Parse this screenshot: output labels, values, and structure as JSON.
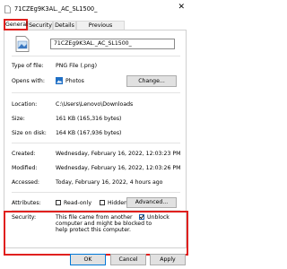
{
  "window": {
    "title": "71CZEg9K3AL._AC_SL1500_",
    "close_glyph": "✕"
  },
  "tabs": [
    {
      "label": "General",
      "active": true
    },
    {
      "label": "Security"
    },
    {
      "label": "Details"
    },
    {
      "label": "Previous Versions"
    }
  ],
  "file": {
    "name": "71CZEg9K3AL._AC_SL1500_"
  },
  "type": {
    "label": "Type of file:",
    "value": "PNG File (.png)"
  },
  "opens": {
    "label": "Opens with:",
    "value": "Photos",
    "button": "Change..."
  },
  "location": {
    "label": "Location:",
    "value": "C:\\Users\\Lenovo\\Downloads"
  },
  "size": {
    "label": "Size:",
    "value": "161 KB (165,316 bytes)"
  },
  "size_on_disk": {
    "label": "Size on disk:",
    "value": "164 KB (167,936 bytes)"
  },
  "created": {
    "label": "Created:",
    "value": "Wednesday, February 16, 2022, 12:03:23 PM"
  },
  "modified": {
    "label": "Modified:",
    "value": "Wednesday, February 16, 2022, 12:03:26 PM"
  },
  "accessed": {
    "label": "Accessed:",
    "value": "Today, February 16, 2022, 4 hours ago"
  },
  "attributes": {
    "label": "Attributes:",
    "readonly": "Read-only",
    "hidden": "Hidden",
    "advanced": "Advanced..."
  },
  "security": {
    "label": "Security:",
    "message": [
      "This file came from another",
      "computer and might be blocked to",
      "help protect this computer."
    ],
    "unblock": "Unblock",
    "unblock_checked": true
  },
  "buttons": {
    "ok": "OK",
    "cancel": "Cancel",
    "apply": "Apply"
  },
  "colors": {
    "highlight": "#e0201e"
  }
}
